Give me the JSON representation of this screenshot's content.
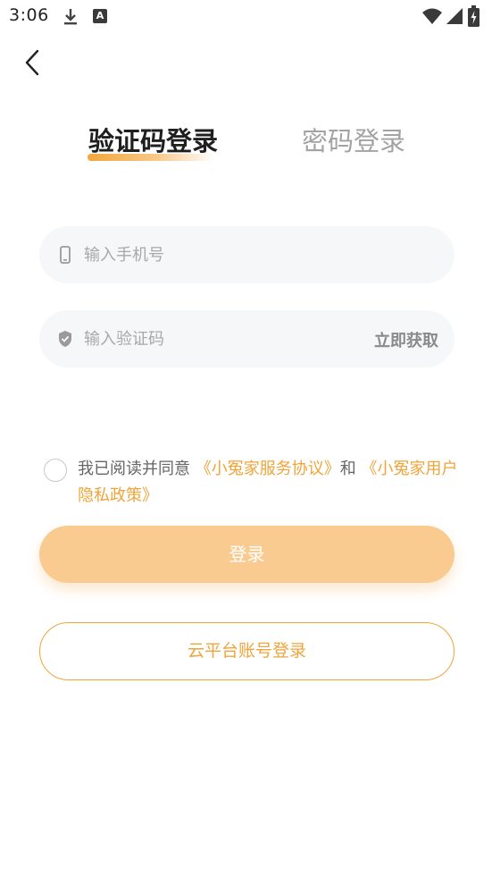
{
  "status_bar": {
    "time": "3:06",
    "icons": [
      "download-icon",
      "a-badge-icon",
      "wifi-icon",
      "signal-icon",
      "battery-charging-icon"
    ],
    "a_badge": "A"
  },
  "nav": {
    "back_icon": "chevron-left-icon"
  },
  "tabs": [
    {
      "label": "验证码登录",
      "active": true
    },
    {
      "label": "密码登录",
      "active": false
    }
  ],
  "form": {
    "phone": {
      "placeholder": "输入手机号",
      "value": "",
      "icon": "phone-icon"
    },
    "code": {
      "placeholder": "输入验证码",
      "value": "",
      "icon": "shield-check-icon",
      "get_code_label": "立即获取"
    }
  },
  "agreement": {
    "checked": false,
    "prefix": "我已阅读并同意",
    "link1": "《小冤家服务协议》",
    "middle": "和",
    "link2": "《小冤家用户隐私政策》"
  },
  "buttons": {
    "login_label": "登录",
    "cloud_login_label": "云平台账号登录"
  },
  "colors": {
    "accent": "#f0a43a",
    "login_bg": "#facb91",
    "field_bg": "#f6f7f9"
  }
}
